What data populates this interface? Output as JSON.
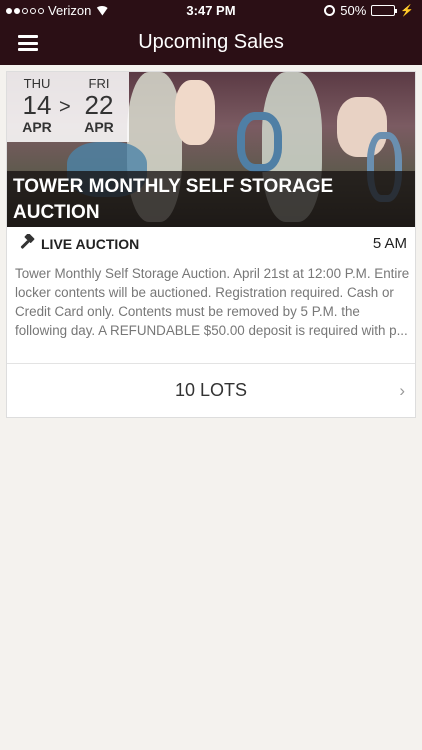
{
  "status": {
    "carrier": "Verizon",
    "time": "3:47 PM",
    "battery": "50%",
    "battery_level": 0.5
  },
  "header": {
    "title": "Upcoming Sales"
  },
  "sale": {
    "start": {
      "dow": "THU",
      "day": "14",
      "month": "APR"
    },
    "separator": ">",
    "end": {
      "dow": "FRI",
      "day": "22",
      "month": "APR"
    },
    "title": "TOWER MONTHLY SELF STORAGE AUCTION",
    "type": "LIVE AUCTION",
    "time": "5 AM",
    "description": "Tower Monthly Self Storage Auction. April 21st  at 12:00 P.M. Entire locker contents will be auctioned.  Registration required. Cash or Credit Card only. Contents must be removed by 5 P.M. the following day. A REFUNDABLE $50.00 deposit is required with p...",
    "lots_label": "10 LOTS",
    "chevron": "›"
  }
}
